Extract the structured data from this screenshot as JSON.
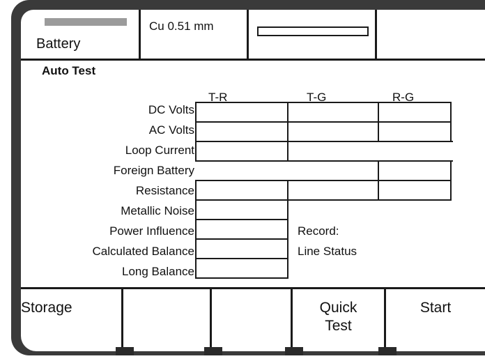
{
  "status_bar": {
    "battery_label": "Battery",
    "battery_level_color": "#9b9b9b",
    "cable_label": "Cu 0.51 mm"
  },
  "auto_test": {
    "title": "Auto Test",
    "columns": [
      "T-R",
      "T-G",
      "R-G"
    ],
    "rows": [
      "DC Volts",
      "AC Volts",
      "Loop Current",
      "Foreign Battery",
      "Resistance",
      "Metallic Noise",
      "Power Influence",
      "Calculated Balance",
      "Long Balance"
    ],
    "record_label": "Record:",
    "line_status_label": "Line Status"
  },
  "softkeys": {
    "storage": "Storage",
    "quick_test_line1": "Quick",
    "quick_test_line2": "Test",
    "start": "Start"
  }
}
